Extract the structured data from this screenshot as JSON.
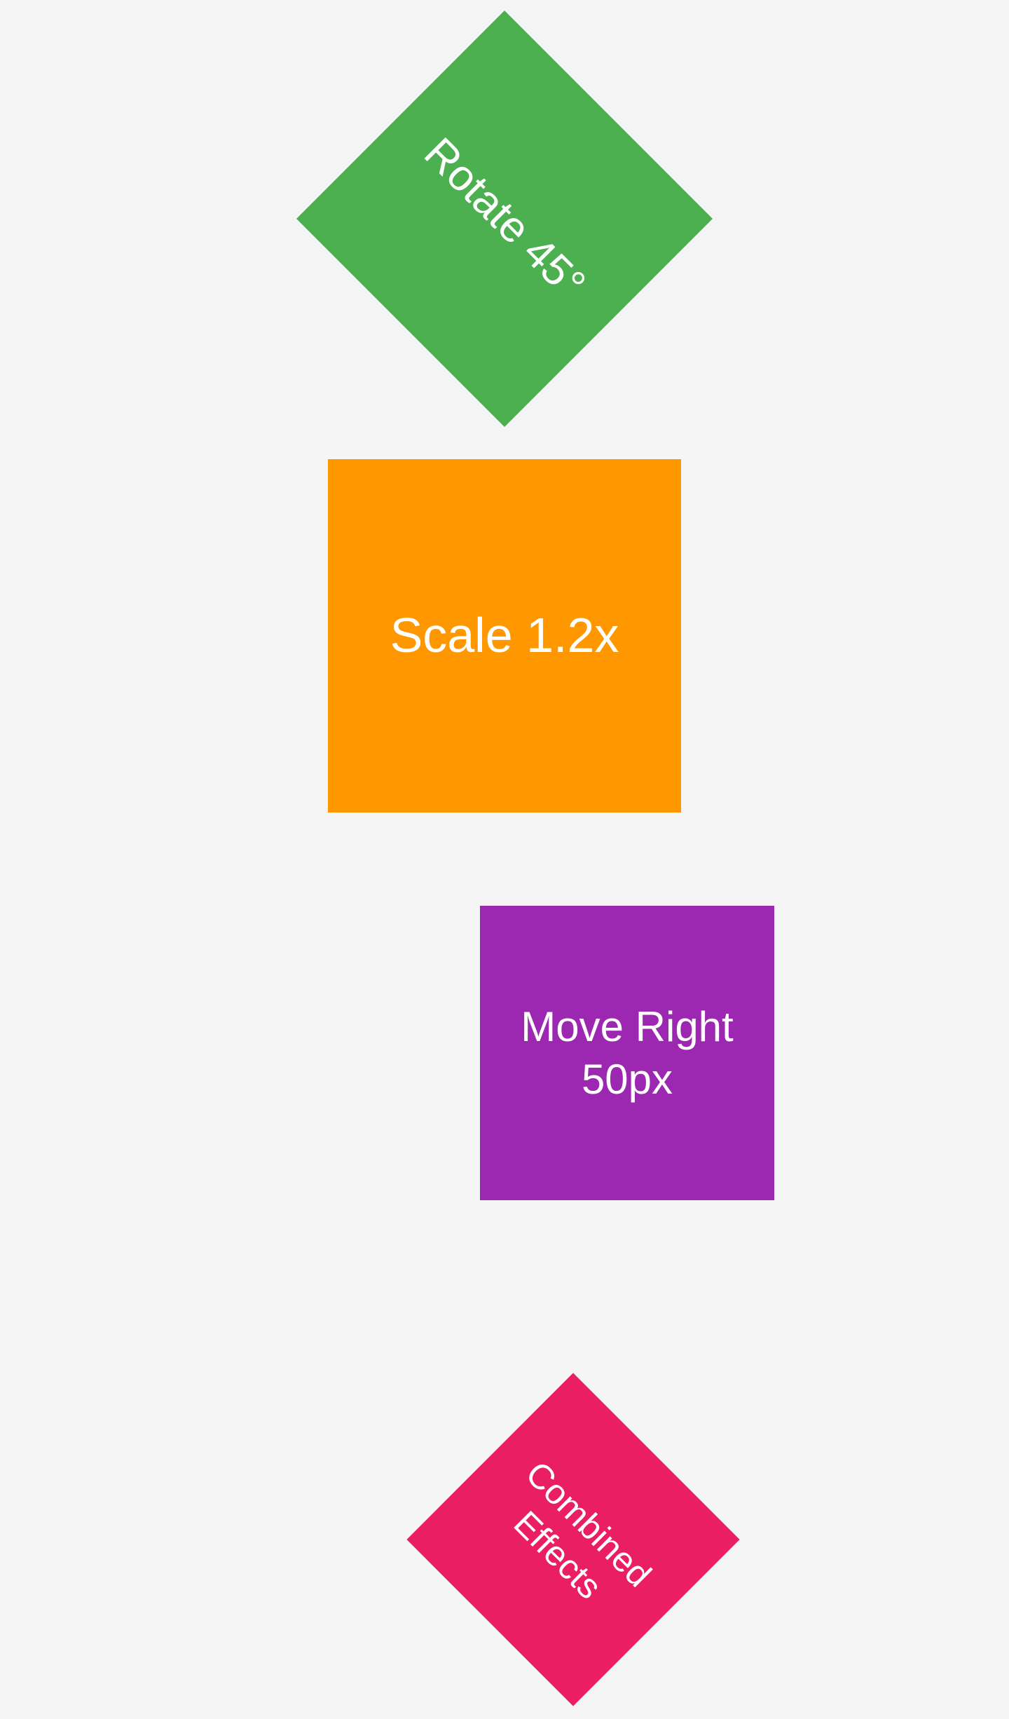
{
  "boxes": {
    "rotate": {
      "label": "Rotate 45°",
      "color": "#4caf50"
    },
    "scale": {
      "label": "Scale 1.2x",
      "color": "#ff9800"
    },
    "move": {
      "label": "Move Right 50px",
      "color": "#9c27b0"
    },
    "combined": {
      "label": "Combined Effects",
      "color": "#e91e63"
    }
  }
}
